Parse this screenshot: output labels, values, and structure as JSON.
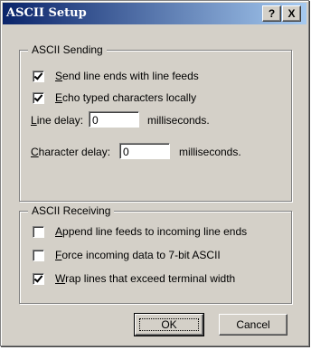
{
  "window": {
    "title": "ASCII Setup",
    "help_label": "?",
    "close_label": "X"
  },
  "sending": {
    "legend": "ASCII Sending",
    "send_line_ends": {
      "label": "Send line ends with line feeds",
      "accel": "S",
      "rest": "end line ends with line feeds",
      "checked": true
    },
    "echo_typed": {
      "label": "Echo typed characters locally",
      "accel": "E",
      "rest": "cho typed characters locally",
      "checked": true
    },
    "line_delay": {
      "accel": "L",
      "rest": "ine delay:",
      "value": "0",
      "unit": "milliseconds."
    },
    "char_delay": {
      "accel": "C",
      "rest": "haracter delay:",
      "value": "0",
      "unit": "milliseconds."
    }
  },
  "receiving": {
    "legend": "ASCII Receiving",
    "append_lf": {
      "accel": "A",
      "rest": "ppend line feeds to incoming line ends",
      "checked": false
    },
    "force_7bit": {
      "accel": "F",
      "rest": "orce incoming data to 7-bit ASCII",
      "checked": false
    },
    "wrap_lines": {
      "accel": "W",
      "rest": "rap lines that exceed terminal width",
      "checked": true
    }
  },
  "buttons": {
    "ok": "OK",
    "cancel": "Cancel"
  }
}
